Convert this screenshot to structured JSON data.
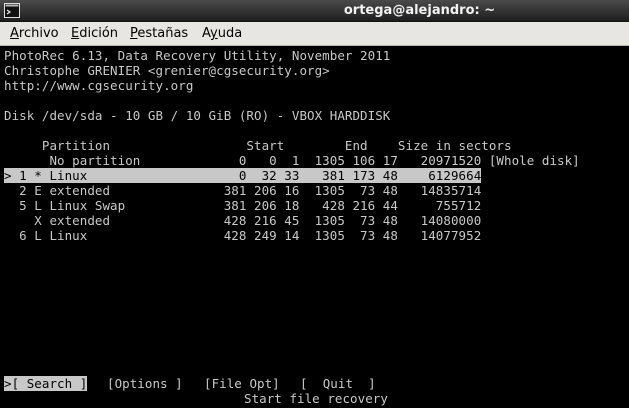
{
  "window": {
    "title": "ortega@alejandro: ~"
  },
  "menubar": {
    "items": [
      {
        "label": "Archivo",
        "ul": "A",
        "rest": "rchivo"
      },
      {
        "label": "Edición",
        "ul": "E",
        "rest": "dición"
      },
      {
        "label": "Pestañas",
        "ul": "P",
        "rest": "estañas"
      },
      {
        "label": "Ayuda",
        "ul": "y",
        "pre": "A",
        "rest": "uda"
      }
    ]
  },
  "terminal": {
    "header": [
      "PhotoRec 6.13, Data Recovery Utility, November 2011",
      "Christophe GRENIER <grenier@cgsecurity.org>",
      "http://www.cgsecurity.org"
    ],
    "disk_line": "Disk /dev/sda - 10 GB / 10 GiB (RO) - VBOX HARDDISK",
    "table_header": "     Partition                  Start        End    Size in sectors",
    "no_partition": "      No partition             0   0  1  1305 106 17   20971520 [Whole disk]",
    "rows": [
      {
        "text": "> 1 * Linux                    0  32 33   381 173 48    6129664",
        "selected": true
      },
      {
        "text": "  2 E extended               381 206 16  1305  73 48   14835714",
        "selected": false
      },
      {
        "text": "  5 L Linux Swap             381 206 18   428 216 44     755712",
        "selected": false
      },
      {
        "text": "    X extended               428 216 45  1305  73 48   14080000",
        "selected": false
      },
      {
        "text": "  6 L Linux                  428 249 14  1305  73 48   14077952",
        "selected": false
      }
    ],
    "actions": {
      "search": ">[ Search ]",
      "options": "[Options ]",
      "file_opt": "[File Opt]",
      "quit": "[  Quit  ]"
    },
    "hint": "Start file recovery"
  }
}
